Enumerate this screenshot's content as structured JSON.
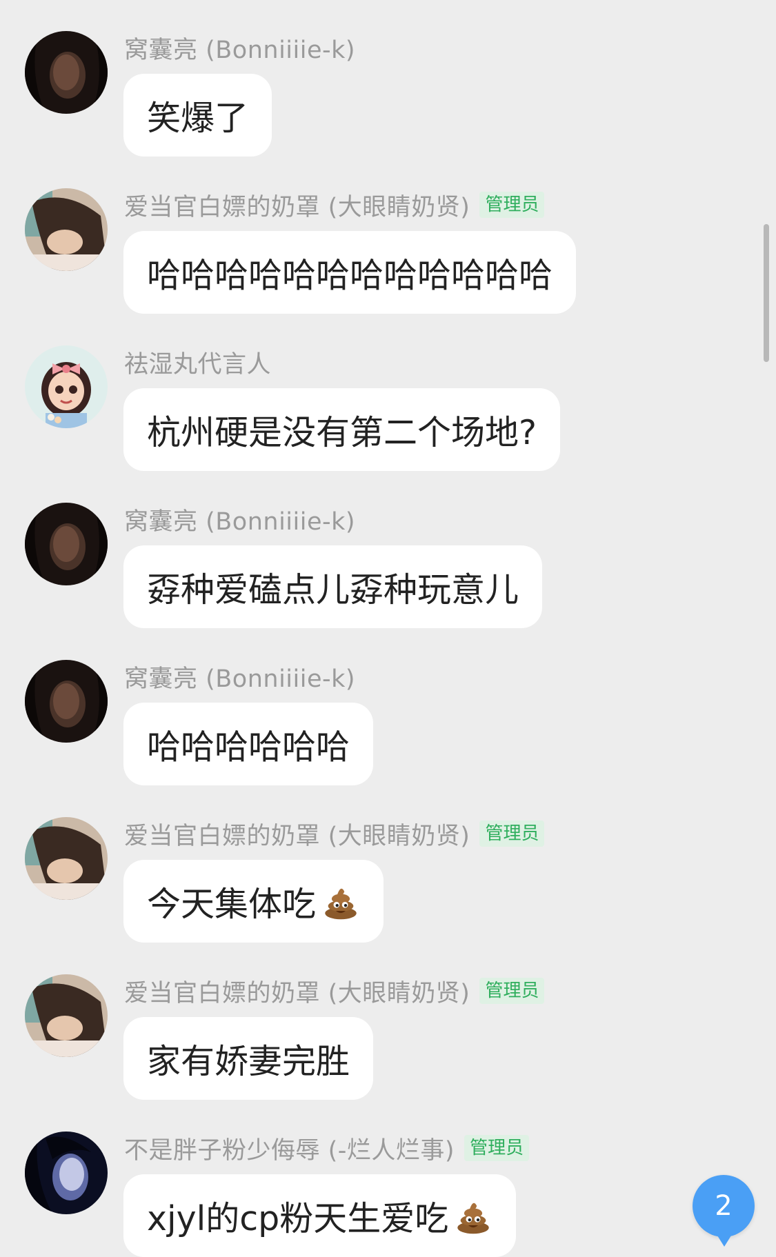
{
  "messages": [
    {
      "sender": "窝囊亮 (Bonniiiie-k)",
      "badge": "",
      "text": "笑爆了",
      "emoji": "",
      "avatar": "dark-portrait"
    },
    {
      "sender": "爱当官白嫖的奶罩 (大眼睛奶贤)",
      "badge": "管理员",
      "text": "哈哈哈哈哈哈哈哈哈哈哈哈",
      "emoji": "",
      "avatar": "lying-girl"
    },
    {
      "sender": "祛湿丸代言人",
      "badge": "",
      "text": "杭州硬是没有第二个场地?",
      "emoji": "",
      "avatar": "cartoon-girl"
    },
    {
      "sender": "窝囊亮 (Bonniiiie-k)",
      "badge": "",
      "text": "孬种爱磕点儿孬种玩意儿",
      "emoji": "",
      "avatar": "dark-portrait"
    },
    {
      "sender": "窝囊亮 (Bonniiiie-k)",
      "badge": "",
      "text": "哈哈哈哈哈哈",
      "emoji": "",
      "avatar": "dark-portrait"
    },
    {
      "sender": "爱当官白嫖的奶罩 (大眼睛奶贤)",
      "badge": "管理员",
      "text": "今天集体吃",
      "emoji": "pile-of-poo",
      "avatar": "lying-girl"
    },
    {
      "sender": "爱当官白嫖的奶罩 (大眼睛奶贤)",
      "badge": "管理员",
      "text": "家有娇妻完胜",
      "emoji": "",
      "avatar": "lying-girl"
    },
    {
      "sender": "不是胖子粉少侮辱 (-烂人烂事)",
      "badge": "管理员",
      "text": "xjyl的cp粉天生爱吃",
      "emoji": "pile-of-poo",
      "avatar": "dark-blue-portrait"
    }
  ],
  "unread_count": "2",
  "colors": {
    "background": "#ededed",
    "bubble": "#ffffff",
    "badge_text": "#2fae5d",
    "badge_bg": "#dff1e4",
    "unread_bg": "#4a9ff5"
  }
}
